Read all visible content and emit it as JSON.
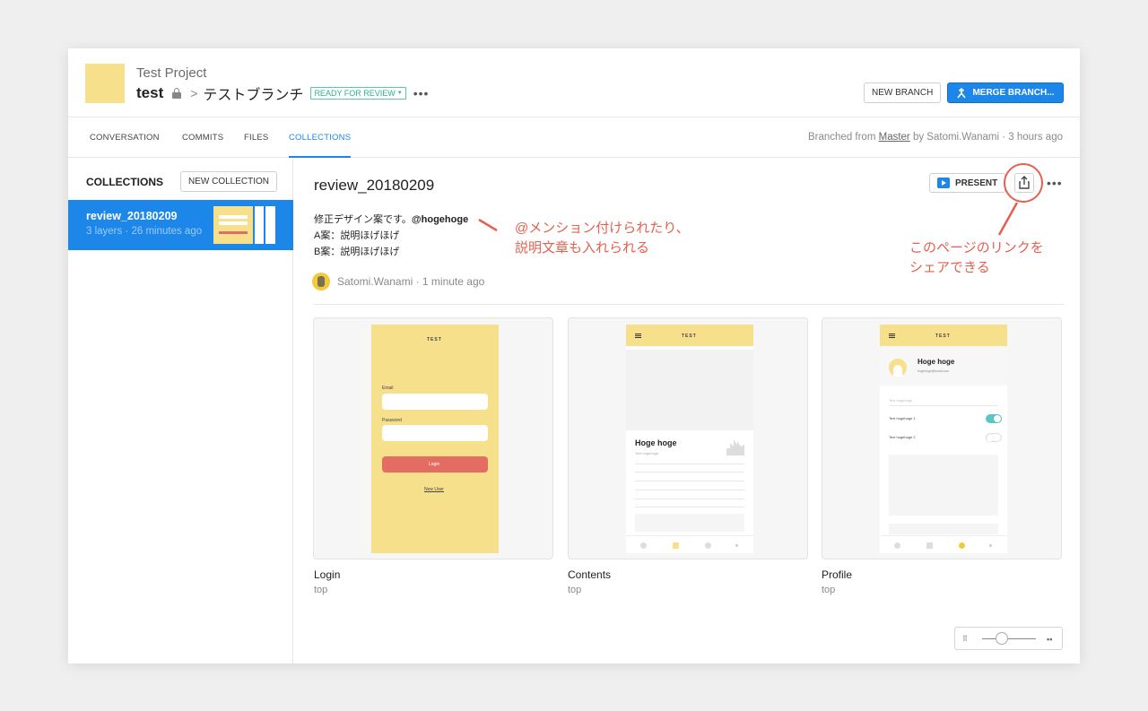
{
  "header": {
    "project_name": "Test  Project",
    "repo": "test",
    "branch_separator": ">",
    "branch_name": "テストブランチ",
    "status_badge": "READY FOR REVIEW",
    "new_branch": "NEW BRANCH",
    "merge_branch": "MERGE BRANCH..."
  },
  "tabs": [
    {
      "label": "CONVERSATION"
    },
    {
      "label": "COMMITS"
    },
    {
      "label": "FILES"
    },
    {
      "label": "COLLECTIONS",
      "active": true
    }
  ],
  "branched_info": {
    "prefix": "Branched from ",
    "source": "Master",
    "suffix": " by Satomi.Wanami · 3 hours ago"
  },
  "sidebar": {
    "title": "COLLECTIONS",
    "new_collection": "NEW COLLECTION",
    "items": [
      {
        "name": "review_20180209",
        "meta": "3 layers · 26 minutes ago"
      }
    ]
  },
  "collection": {
    "title": "review_20180209",
    "present": "PRESENT",
    "description_line1": "修正デザイン案です。",
    "mention": "@hogehoge",
    "description_line2": "A案：説明ほげほげ",
    "description_line3": "B案：説明ほげほげ",
    "author": "Satomi.Wanami · 1 minute ago"
  },
  "annotations": {
    "mention_note_1": "@メンション付けられたり、",
    "mention_note_2": "説明文章も入れられる",
    "share_note_1": "このページのリンクを",
    "share_note_2": "シェアできる"
  },
  "cards": [
    {
      "name": "Login",
      "sub": "top"
    },
    {
      "name": "Contents",
      "sub": "top"
    },
    {
      "name": "Profile",
      "sub": "top"
    }
  ],
  "mockups": {
    "app_title": "TEST",
    "email_label": "Email",
    "password_label": "Password",
    "login_button": "Login",
    "new_user_link": "New User",
    "contents_heading": "Hoge hoge",
    "contents_sub": "Text hogehoge",
    "profile_name": "Hoge hoge",
    "profile_email": "hogehoge@email.com",
    "profile_section": "Text hogehoge",
    "profile_setting1": "Text hogehoge 1",
    "profile_setting2": "Text hogehoge 2",
    "profile_setting1_on": true,
    "profile_setting2_on": false
  },
  "colors": {
    "accent": "#1c87e8",
    "annotation": "#e4604f",
    "status": "#2bb38b",
    "mock_yellow": "#f7e08c"
  },
  "icons": [
    "lock-icon",
    "merge-icon",
    "present-icon",
    "share-icon",
    "more-icon",
    "zoom-small-grid-icon",
    "zoom-large-grid-icon"
  ]
}
